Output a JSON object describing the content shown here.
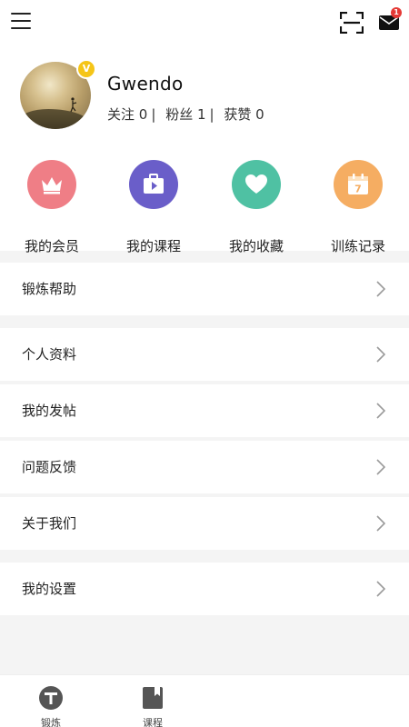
{
  "header": {
    "menu_icon": "hamburger-menu-icon",
    "scan_icon": "scan-frame-icon",
    "mail_icon": "envelope-icon",
    "mail_badge": "1"
  },
  "profile": {
    "username": "Gwendo",
    "vip_badge": "V",
    "following_label": "关注",
    "following_count": "0",
    "fans_label": "粉丝",
    "fans_count": "1",
    "likes_label": "获赞",
    "likes_count": "0"
  },
  "quick_actions": [
    {
      "label": "我的会员",
      "icon": "crown-icon",
      "color": "#ef7e86"
    },
    {
      "label": "我的课程",
      "icon": "course-bag-icon",
      "color": "#6a5ec9"
    },
    {
      "label": "我的收藏",
      "icon": "heart-icon",
      "color": "#4fc1a3"
    },
    {
      "label": "训练记录",
      "icon": "calendar-icon",
      "color": "#f5ad62",
      "calendar_day": "7"
    }
  ],
  "menu": {
    "help": "锻炼帮助",
    "profile": "个人资料",
    "posts": "我的发帖",
    "feedback": "问题反馈",
    "about": "关于我们",
    "settings": "我的设置"
  },
  "tabbar": {
    "tabs": [
      {
        "label": "锻炼",
        "icon": "exercise-t-icon"
      },
      {
        "label": "课程",
        "icon": "bookmark-book-icon"
      }
    ]
  }
}
